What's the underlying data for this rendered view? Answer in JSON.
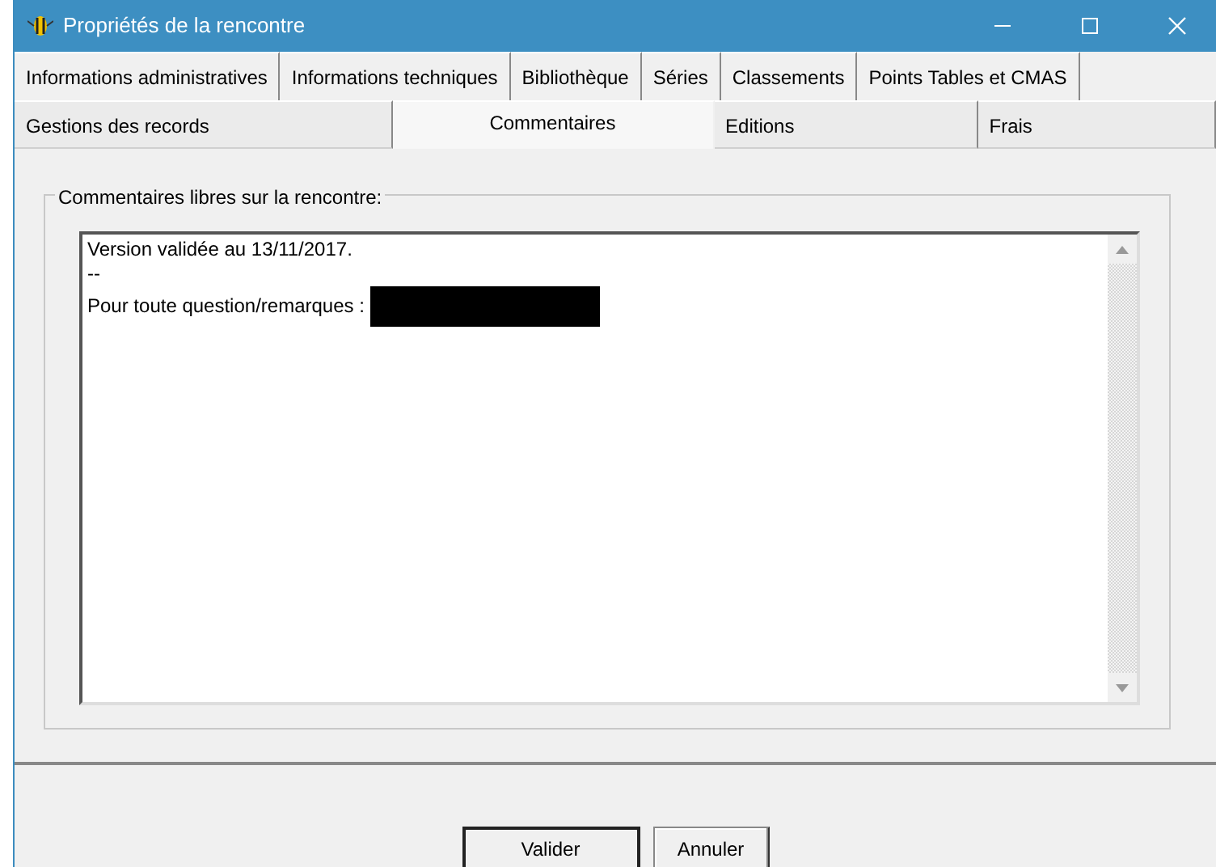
{
  "window": {
    "title": "Propriétés de la rencontre"
  },
  "tab_rows": [
    {
      "tabs": [
        {
          "label": "Informations administratives",
          "selected": false
        },
        {
          "label": "Informations techniques",
          "selected": false
        },
        {
          "label": "Bibliothèque",
          "selected": false
        },
        {
          "label": "Séries",
          "selected": false
        },
        {
          "label": "Classements",
          "selected": false
        },
        {
          "label": "Points Tables et CMAS",
          "selected": false
        }
      ]
    },
    {
      "tabs": [
        {
          "label": "Gestions des records",
          "selected": false
        },
        {
          "label": "Commentaires",
          "selected": true
        },
        {
          "label": "Editions",
          "selected": false
        },
        {
          "label": "Frais",
          "selected": false
        }
      ]
    }
  ],
  "group": {
    "label": "Commentaires libres sur la rencontre:",
    "lines": [
      {
        "text": "Version validée au 13/11/2017.",
        "redacted": false
      },
      {
        "text": "--",
        "redacted": false
      },
      {
        "text": "Pour toute question/remarques :",
        "redacted": true
      }
    ]
  },
  "buttons": [
    "Valider",
    "Annuler"
  ]
}
